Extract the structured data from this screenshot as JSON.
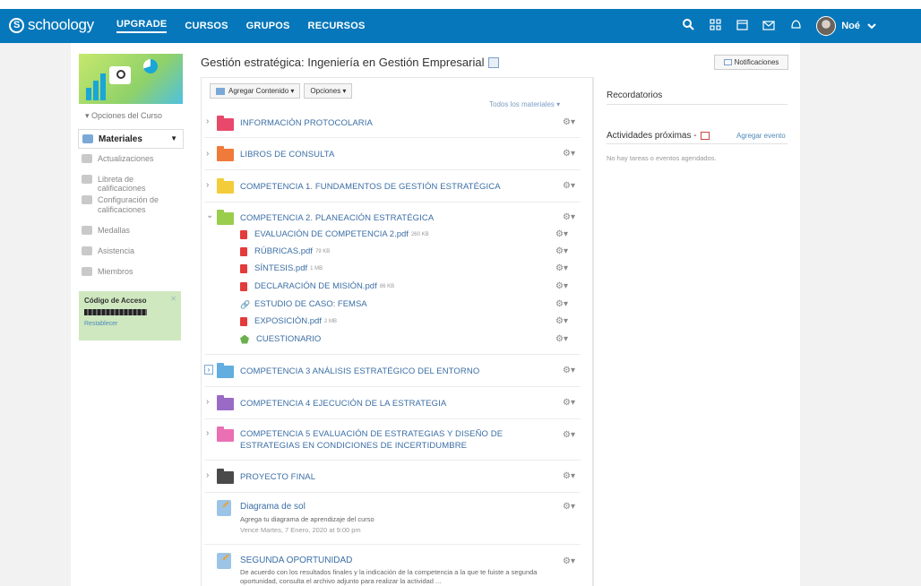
{
  "brand": {
    "name": "schoology"
  },
  "nav": {
    "items": [
      "UPGRADE",
      "CURSOS",
      "GRUPOS",
      "RECURSOS"
    ]
  },
  "topbar": {
    "icons": [
      "search-icon",
      "apps-grid-icon",
      "calendar-icon",
      "mail-icon",
      "notifications-icon"
    ],
    "user": "Noé"
  },
  "sidebar": {
    "course_options": "▾ Opciones del Curso",
    "items": [
      {
        "label": "Materiales",
        "icon": "materials-icon"
      },
      {
        "label": "Actualizaciones",
        "icon": "updates-icon"
      },
      {
        "label": "Libreta de calificaciones",
        "icon": "gradebook-icon"
      },
      {
        "label": "Configuración de calificaciones",
        "icon": "grade-settings-icon"
      },
      {
        "label": "Medallas",
        "icon": "badge-icon"
      },
      {
        "label": "Asistencia",
        "icon": "attendance-icon"
      },
      {
        "label": "Miembros",
        "icon": "members-icon"
      }
    ],
    "access": {
      "title": "Código de Acceso",
      "reset": "Restablecer"
    }
  },
  "main": {
    "title": "Gestión estratégica: Ingeniería en Gestión Empresarial",
    "notifications_btn": "Notificaciones",
    "add_content": "Agregar Contenido ▾",
    "options": "Opciones ▾",
    "all_materials": "Todos los materiales ▾",
    "folders": [
      {
        "title": "INFORMACIÓN PROTOCOLARIA",
        "color": "#e8486b"
      },
      {
        "title": "LIBROS DE CONSULTA",
        "color": "#f07a3a"
      },
      {
        "title": "COMPETENCIA 1. FUNDAMENTOS DE GESTIÓN ESTRATÉGICA",
        "color": "#f3cc3a"
      },
      {
        "title": "COMPETENCIA 2. PLANEACIÓN ESTRATÉGICA",
        "color": "#9acd4c"
      },
      {
        "title": "COMPETENCIA 3 ANÁLISIS ESTRATÉGICO DEL ENTORNO",
        "color": "#62aee0"
      },
      {
        "title": "COMPETENCIA 4 EJECUCIÓN DE LA ESTRATEGIA",
        "color": "#9a6bc6"
      },
      {
        "title": "COMPETENCIA 5 EVALUACIÓN DE ESTRATEGIAS Y DISEÑO DE ESTRATEGIAS EN CONDICIONES DE INCERTIDUMBRE",
        "color": "#ea6fb3"
      },
      {
        "title": "PROYECTO FINAL",
        "color": "#4a4a4a"
      }
    ],
    "subitems": [
      {
        "title": "EVALUACIÓN DE COMPETENCIA 2.pdf",
        "size": "260 KB",
        "type": "pdf"
      },
      {
        "title": "RÚBRICAS.pdf",
        "size": "79 KB",
        "type": "pdf"
      },
      {
        "title": "SÍNTESIS.pdf",
        "size": "1 MB",
        "type": "pdf"
      },
      {
        "title": "DECLARACIÓN DE MISIÓN.pdf",
        "size": "86 KB",
        "type": "pdf"
      },
      {
        "title": "ESTUDIO DE CASO: FEMSA",
        "size": "",
        "type": "link"
      },
      {
        "title": "EXPOSICIÓN.pdf",
        "size": "2 MB",
        "type": "pdf"
      },
      {
        "title": "CUESTIONARIO",
        "size": "",
        "type": "quiz"
      }
    ],
    "assignments": [
      {
        "title": "Diagrama de sol",
        "desc": "Agrega tu diagrama de aprendizaje del curso",
        "due": "Vence Martes, 7 Enero, 2020 at 9:00 pm"
      },
      {
        "title": "SEGUNDA OPORTUNIDAD",
        "desc": "De acuerdo con los resultados finales y la indicación de la competencia a la que te fuiste a segunda oportunidad, consulta el archivo adjunto para realizar la actividad ...",
        "due": ""
      }
    ]
  },
  "right": {
    "reminders": "Recordatorios",
    "upcoming": "Actividades próximas -",
    "add_event": "Agregar evento",
    "empty": "No hay tareas o eventos agendados."
  }
}
